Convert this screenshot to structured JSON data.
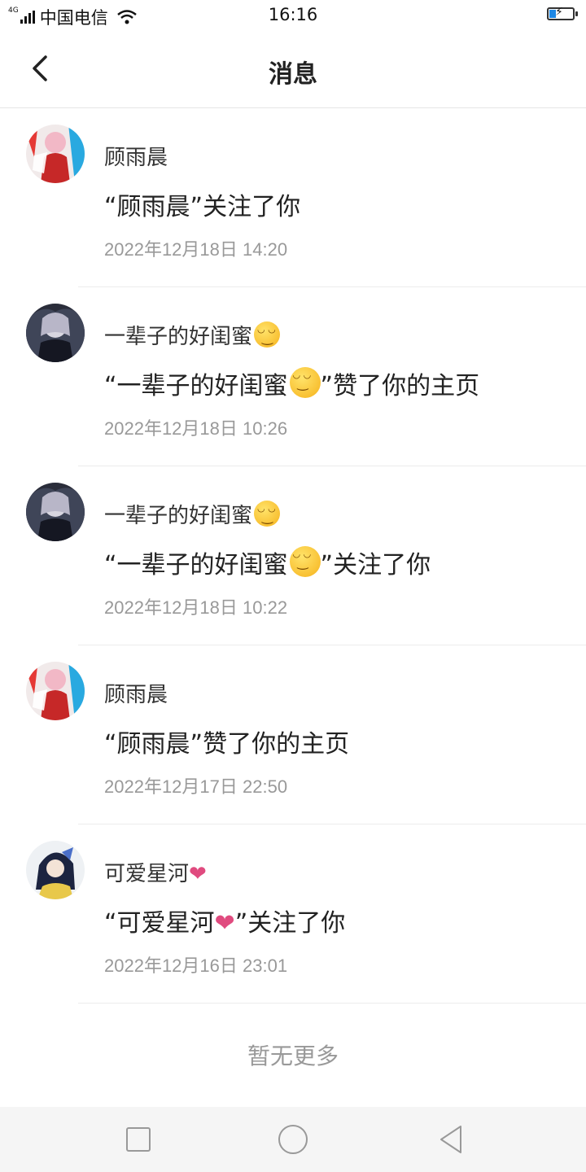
{
  "status_bar": {
    "network": "4G",
    "carrier": "中国电信",
    "time": "16:16"
  },
  "header": {
    "title": "消息"
  },
  "messages": [
    {
      "name": "顾雨晨",
      "text": "“顾雨晨”关注了你",
      "time": "2022年12月18日 14:20",
      "avatar": "avatar-pink"
    },
    {
      "name": "一辈子的好闺蜜",
      "text_before": "“一辈子的好闺蜜",
      "text_after": "”赞了你的主页",
      "time": "2022年12月18日 10:26",
      "avatar": "avatar-dark"
    },
    {
      "name": "一辈子的好闺蜜",
      "text_before": "“一辈子的好闺蜜",
      "text_after": "”关注了你",
      "time": "2022年12月18日 10:22",
      "avatar": "avatar-dark"
    },
    {
      "name": "顾雨晨",
      "text": "“顾雨晨”赞了你的主页",
      "time": "2022年12月17日 22:50",
      "avatar": "avatar-pink"
    },
    {
      "name": "可爱星河",
      "text_before": "“可爱星河",
      "text_after": "”关注了你",
      "time": "2022年12月16日 23:01",
      "avatar": "avatar-light"
    }
  ],
  "footer": {
    "no_more": "暂无更多"
  },
  "icons": {
    "back": "chevron-left-icon",
    "smile": "smiling-face-emoji",
    "heart": "heart-emoji",
    "nav_recent": "square-icon",
    "nav_home": "circle-icon",
    "nav_back": "triangle-back-icon"
  },
  "colors": {
    "heart": "#e04b7f",
    "time_text": "#999999",
    "battery_fill": "#1e88e5"
  }
}
